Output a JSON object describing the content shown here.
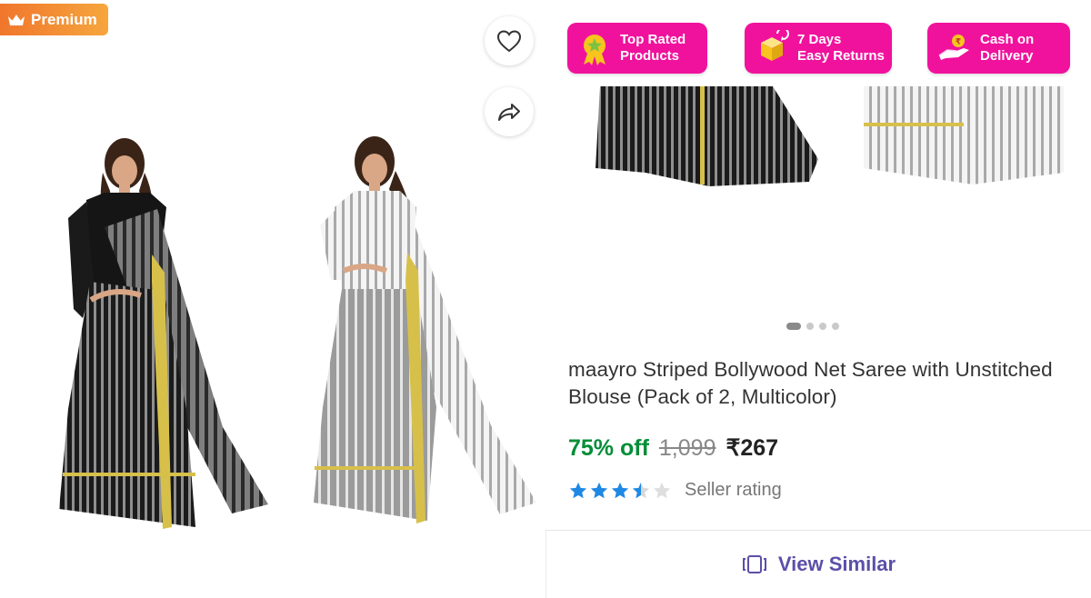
{
  "premium_badge": {
    "label": "Premium",
    "icon": "crown-icon"
  },
  "actions": {
    "wishlist_icon": "heart-icon",
    "share_icon": "share-arrow-icon"
  },
  "product_images": [
    {
      "name": "black-grey-saree",
      "colors": [
        "#111111",
        "#8c8c8c"
      ]
    },
    {
      "name": "white-grey-saree",
      "colors": [
        "#f2f2f2",
        "#9a9a9a"
      ]
    }
  ],
  "trust_badges": [
    {
      "line1": "Top Rated",
      "line2": "Products",
      "icon": "rosette-star-icon"
    },
    {
      "line1": "7 Days",
      "line2": "Easy Returns",
      "icon": "box-return-icon"
    },
    {
      "line1": "Cash on",
      "line2": "Delivery",
      "icon": "hand-coin-icon"
    }
  ],
  "carousel": {
    "total": 4,
    "active": 1
  },
  "product": {
    "title": "maayro Striped Bollywood Net Saree with Unstitched Blouse (Pack of 2, Multicolor)",
    "discount": "75% off",
    "mrp": "1,099",
    "price": "₹267",
    "rating_stars": 3.5,
    "rating_label": "Seller rating"
  },
  "view_similar": {
    "label": "View Similar",
    "icon": "similar-cards-icon"
  },
  "colors": {
    "badge_pink": "#f0129d",
    "discount_green": "#038d37",
    "accent_purple": "#5b4fa8",
    "star_blue": "#1e88e5",
    "premium_orange": "#f2873a"
  }
}
